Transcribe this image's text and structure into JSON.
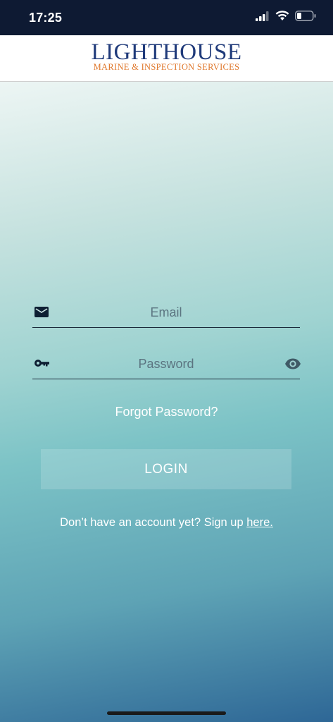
{
  "status_bar": {
    "time": "17:25",
    "icons": [
      "cellular-signal-icon",
      "wifi-icon",
      "battery-icon"
    ]
  },
  "header": {
    "brand_title": "LIGHTHOUSE",
    "brand_subtitle": "MARINE & INSPECTION SERVICES"
  },
  "form": {
    "email": {
      "icon": "mail-icon",
      "placeholder": "Email",
      "value": ""
    },
    "password": {
      "icon": "key-icon",
      "placeholder": "Password",
      "value": "",
      "toggle_icon": "eye-icon"
    },
    "forgot_label": "Forgot Password?",
    "login_label": "LOGIN",
    "signup_text": "Don’t have an account yet? Sign up ",
    "signup_link": "here."
  },
  "colors": {
    "status_bar_bg": "#0e1a33",
    "brand_blue": "#1f3a7a",
    "brand_orange": "#e0782c",
    "field_line": "#1b2a3a"
  }
}
